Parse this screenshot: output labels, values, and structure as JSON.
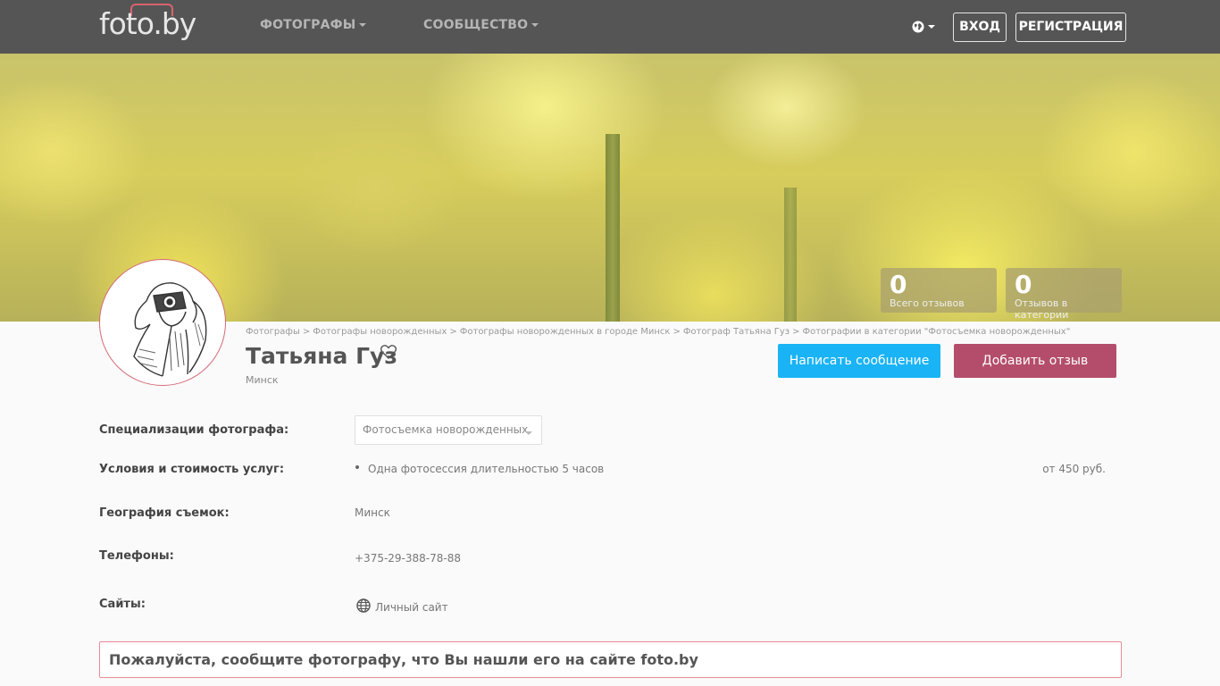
{
  "header": {
    "logo_text": "foto.by",
    "nav": [
      "ФОТОГРАФЫ",
      "СООБЩЕСТВО"
    ],
    "login_label": "ВХОД",
    "register_label": "РЕГИСТРАЦИЯ"
  },
  "stats": [
    {
      "value": "0",
      "label": "Всего отзывов"
    },
    {
      "value": "0",
      "label": "Отзывов в категории"
    }
  ],
  "breadcrumb": [
    "Фотографы",
    "Фотографы новорожденных",
    "Фотографы новорожденных в городе Минск",
    "Фотограф Татьяна Гуз",
    "Фотографии в категории \"Фотосъемка новорожденных\""
  ],
  "profile": {
    "name": "Татьяна Гуз",
    "city": "Минск",
    "message_button": "Написать сообщение",
    "review_button": "Добавить отзыв"
  },
  "info": {
    "specializations_label": "Специализации фотографа:",
    "specialization_selected": "Фотосъемка новорожденных",
    "services_label": "Условия и стоимость услуг:",
    "service_item": "Одна фотосессия длительностью 5 часов",
    "service_price": "от 450 руб.",
    "geography_label": "География съемок:",
    "geography_value": "Минск",
    "phones_label": "Телефоны:",
    "phone_value": "+375-29-388-78-88",
    "sites_label": "Сайты:",
    "site_value": "Личный сайт"
  },
  "notice": "Пожалуйста, сообщите фотографу, что Вы нашли его на сайте foto.by",
  "colors": {
    "topbar": "#555555",
    "message_button": "#1ab3f5",
    "review_button": "#b44d6b",
    "notice_border": "#e88b96"
  }
}
